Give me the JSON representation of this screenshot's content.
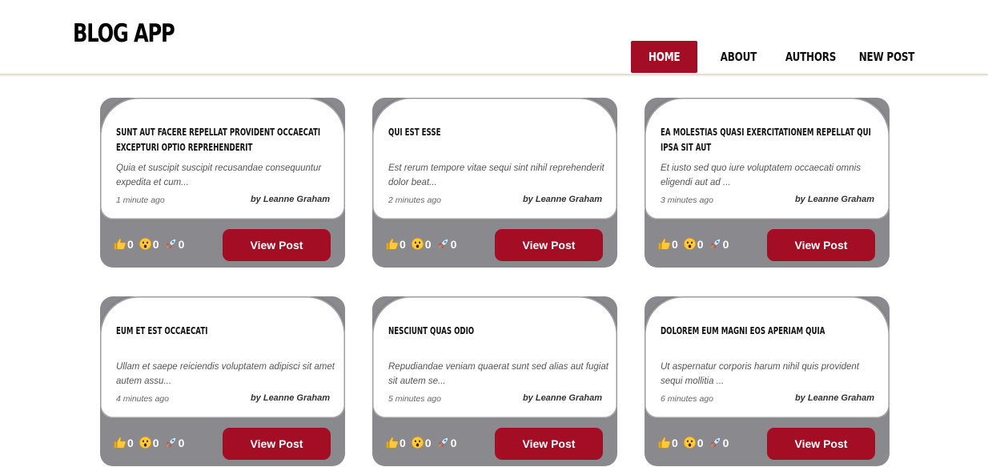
{
  "app": {
    "title": "BLOG APP"
  },
  "nav": [
    {
      "label": "HOME",
      "active": true
    },
    {
      "label": "ABOUT",
      "active": false
    },
    {
      "label": "AUTHORS",
      "active": false
    },
    {
      "label": "NEW POST",
      "active": false
    }
  ],
  "colors": {
    "accent": "#a30e25",
    "card_footer": "#8a8a8e"
  },
  "posts": [
    {
      "title": "sunt aut facere repellat provident occaecati excepturi optio reprehenderit",
      "excerpt": "Quia et suscipit suscipit recusandae consequuntur expedita et cum...",
      "time": "1 minute ago",
      "author": "by Leanne Graham",
      "reactions": {
        "thumbs_up": "0",
        "wow": "0",
        "rocket": "0"
      },
      "button": "View Post"
    },
    {
      "title": "qui est esse",
      "excerpt": "Est rerum tempore vitae sequi sint nihil reprehenderit dolor beat...",
      "time": "2 minutes ago",
      "author": "by Leanne Graham",
      "reactions": {
        "thumbs_up": "0",
        "wow": "0",
        "rocket": "0"
      },
      "button": "View Post"
    },
    {
      "title": "ea molestias quasi exercitationem repellat qui ipsa sit aut",
      "excerpt": "Et iusto sed quo iure voluptatem occaecati omnis eligendi aut ad ...",
      "time": "3 minutes ago",
      "author": "by Leanne Graham",
      "reactions": {
        "thumbs_up": "0",
        "wow": "0",
        "rocket": "0"
      },
      "button": "View Post"
    },
    {
      "title": "eum et est occaecati",
      "excerpt": "Ullam et saepe reiciendis voluptatem adipisci sit amet autem assu...",
      "time": "4 minutes ago",
      "author": "by Leanne Graham",
      "reactions": {
        "thumbs_up": "0",
        "wow": "0",
        "rocket": "0"
      },
      "button": "View Post"
    },
    {
      "title": "nesciunt quas odio",
      "excerpt": "Repudiandae veniam quaerat sunt sed alias aut fugiat sit autem se...",
      "time": "5 minutes ago",
      "author": "by Leanne Graham",
      "reactions": {
        "thumbs_up": "0",
        "wow": "0",
        "rocket": "0"
      },
      "button": "View Post"
    },
    {
      "title": "dolorem eum magni eos aperiam quia",
      "excerpt": "Ut aspernatur corporis harum nihil quis provident sequi mollitia ...",
      "time": "6 minutes ago",
      "author": "by Leanne Graham",
      "reactions": {
        "thumbs_up": "0",
        "wow": "0",
        "rocket": "0"
      },
      "button": "View Post"
    }
  ]
}
